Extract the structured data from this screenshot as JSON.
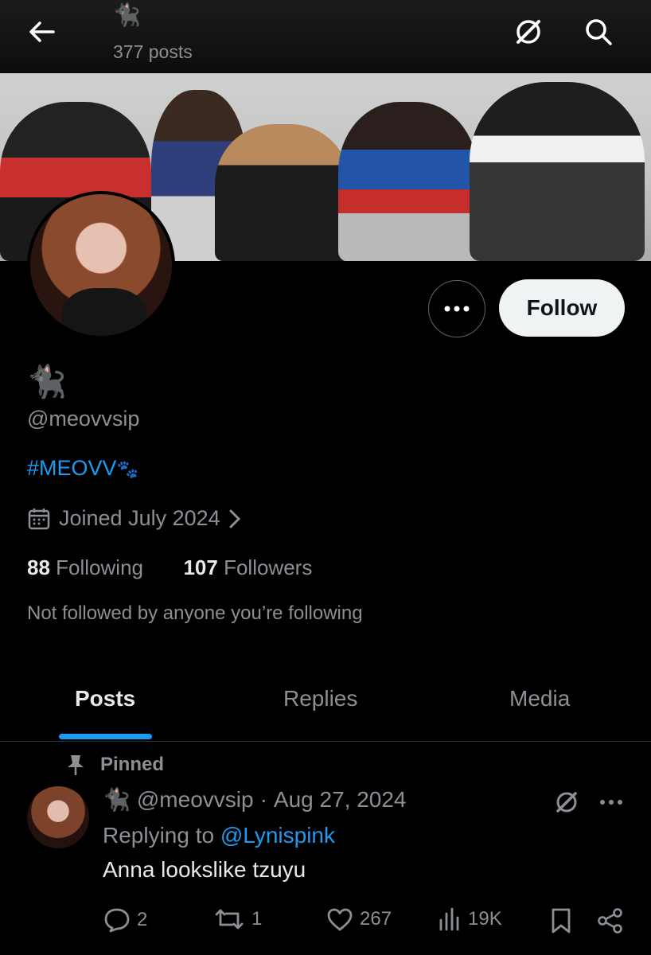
{
  "header": {
    "display_name": "🐈‍⬛",
    "post_count": "377 posts"
  },
  "profile": {
    "display_name": "🐈‍⬛",
    "handle": "@meovvsip",
    "bio_hashtag": "#MEOVV",
    "bio_emoji": "🐾",
    "joined": "Joined July 2024",
    "following_count": "88",
    "following_label": "Following",
    "followers_count": "107",
    "followers_label": "Followers",
    "mutuals_note": "Not followed by anyone you’re following",
    "follow_button": "Follow"
  },
  "tabs": [
    {
      "label": "Posts",
      "active": true
    },
    {
      "label": "Replies",
      "active": false
    },
    {
      "label": "Media",
      "active": false
    }
  ],
  "pinned_post": {
    "pinned_label": "Pinned",
    "author_name": "🐈‍⬛",
    "handle": "@meovvsip",
    "separator": "·",
    "date": "Aug 27, 2024",
    "replying_prefix": "Replying to",
    "replying_to": "@Lynispink",
    "text": "Anna lookslike tzuyu",
    "replies": "2",
    "reposts": "1",
    "likes": "267",
    "views": "19K"
  },
  "colors": {
    "accent": "#1d9bf0",
    "muted": "#8b9096",
    "text": "#e7e9ea",
    "background": "#000000"
  }
}
